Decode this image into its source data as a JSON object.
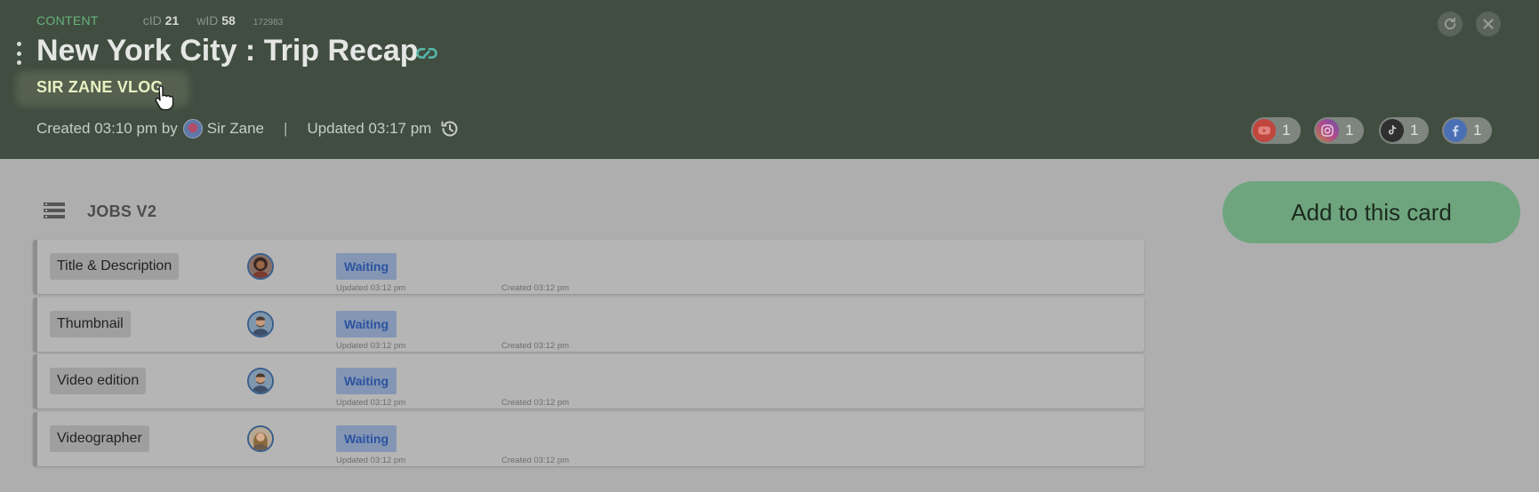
{
  "header": {
    "section_label": "CONTENT",
    "cid_label": "cID",
    "cid_value": "21",
    "wid_label": "wID",
    "wid_value": "58",
    "small_id": "172983",
    "title": "New York City : Trip Recap",
    "subtitle": "SIR ZANE VLOG",
    "created_text": "Created 03:10 pm by",
    "author": "Sir Zane",
    "separator": "|",
    "updated_text": "Updated 03:17 pm",
    "socials": [
      {
        "name": "youtube",
        "count": "1",
        "color": "#c0463e"
      },
      {
        "name": "instagram",
        "count": "1",
        "color": "#b24a8c"
      },
      {
        "name": "tiktok",
        "count": "1",
        "color": "#2f2f2f"
      },
      {
        "name": "facebook",
        "count": "1",
        "color": "#4a6fb5"
      }
    ]
  },
  "jobs_section": {
    "title": "JOBS V2",
    "add_button_label": "Add to this card",
    "jobs": [
      {
        "label": "Title & Description",
        "status": "Waiting",
        "updated": "Updated 03:12 pm",
        "created": "Created 03:12 pm",
        "avatar": "woman-curly"
      },
      {
        "label": "Thumbnail",
        "status": "Waiting",
        "updated": "Updated 03:12 pm",
        "created": "Created 03:12 pm",
        "avatar": "man-beard"
      },
      {
        "label": "Video edition",
        "status": "Waiting",
        "updated": "Updated 03:12 pm",
        "created": "Created 03:12 pm",
        "avatar": "man-beard"
      },
      {
        "label": "Videographer",
        "status": "Waiting",
        "updated": "Updated 03:12 pm",
        "created": "Created 03:12 pm",
        "avatar": "woman-blonde"
      }
    ]
  },
  "colors": {
    "header_bg": "#414d41",
    "accent_green": "#67b47a",
    "add_button": "#6fa57e",
    "status_badge": "#8496b3"
  }
}
